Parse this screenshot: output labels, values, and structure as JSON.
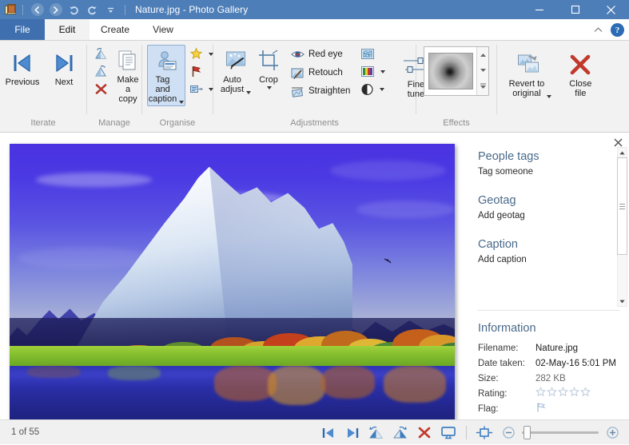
{
  "window": {
    "title": "Nature.jpg - Photo Gallery",
    "app_icon": "photo-gallery-icon",
    "quick_access": [
      {
        "name": "back-button",
        "icon": "back-arrow-icon"
      },
      {
        "name": "forward-button",
        "icon": "forward-arrow-icon"
      },
      {
        "name": "undo-button",
        "icon": "undo-icon"
      },
      {
        "name": "redo-button",
        "icon": "redo-icon"
      },
      {
        "name": "customize-quick-access-button",
        "icon": "chevron-down-icon"
      }
    ],
    "controls": {
      "minimize": "minimize-icon",
      "maximize": "maximize-icon",
      "close": "close-icon"
    }
  },
  "tabs": [
    {
      "label": "File",
      "type": "file",
      "active": false
    },
    {
      "label": "Edit",
      "type": "normal",
      "active": true
    },
    {
      "label": "Create",
      "type": "normal",
      "active": false
    },
    {
      "label": "View",
      "type": "normal",
      "active": false
    }
  ],
  "ribbon": {
    "collapse_icon": "chevron-up-icon",
    "help_label": "?",
    "groups": [
      {
        "label": "Iterate",
        "buttons": [
          {
            "label": "Previous",
            "icon": "previous-icon",
            "selected": false
          },
          {
            "label": "Next",
            "icon": "next-icon",
            "selected": false
          }
        ]
      },
      {
        "label": "Manage",
        "small_buttons": [
          {
            "label": "",
            "icon": "rotate-left-icon"
          },
          {
            "label": "",
            "icon": "rotate-right-icon"
          },
          {
            "label": "",
            "icon": "delete-x-icon"
          }
        ],
        "buttons": [
          {
            "label": "Make\na copy",
            "icon": "copy-icon",
            "selected": false
          }
        ]
      },
      {
        "label": "Organise",
        "buttons": [
          {
            "label": "Tag and\ncaption",
            "icon": "tag-person-icon",
            "selected": true,
            "has_menu": true
          }
        ],
        "small_buttons": [
          {
            "label": "",
            "icon": "star-rating-icon",
            "has_menu": true
          },
          {
            "label": "",
            "icon": "flag-icon",
            "has_menu": false
          },
          {
            "label": "",
            "icon": "caption-tag-icon",
            "has_menu": true
          }
        ]
      },
      {
        "label": "Adjustments",
        "buttons": [
          {
            "label": "Auto\nadjust",
            "icon": "auto-adjust-icon",
            "selected": false,
            "has_menu": true
          },
          {
            "label": "Crop",
            "icon": "crop-icon",
            "selected": false,
            "has_menu": true
          }
        ],
        "small_buttons": [
          {
            "label": "Red eye",
            "icon": "red-eye-icon"
          },
          {
            "label": "Retouch",
            "icon": "retouch-icon"
          },
          {
            "label": "Straighten",
            "icon": "straighten-icon"
          }
        ],
        "swatch_buttons": [
          {
            "label": "",
            "icon": "noise-reduction-icon",
            "has_menu": false
          },
          {
            "label": "",
            "icon": "color-adjust-icon",
            "has_menu": true
          },
          {
            "label": "",
            "icon": "exposure-icon",
            "has_menu": true
          }
        ],
        "fine_tune": {
          "label": "Fine\ntune",
          "icon": "fine-tune-sliders-icon"
        }
      },
      {
        "label": "Effects",
        "gallery": {
          "thumb_name": "effect-thumbnail-grayscale",
          "up_icon": "gallery-up-icon",
          "down_icon": "gallery-down-icon",
          "more_icon": "gallery-more-icon"
        }
      },
      {
        "label": "",
        "buttons": [
          {
            "label": "Revert to\noriginal",
            "icon": "revert-icon",
            "selected": false,
            "has_menu": true
          },
          {
            "label": "Close\nfile",
            "icon": "close-file-x-icon",
            "selected": false
          }
        ]
      }
    ]
  },
  "photo": {
    "name": "photo-canvas",
    "alt": "Snow-capped mountain with autumn trees reflected in a lake"
  },
  "sidebar": {
    "close_icon": "panel-close-icon",
    "sections": [
      {
        "heading": "People tags",
        "link": "Tag someone",
        "link_name": "tag-someone-link"
      },
      {
        "heading": "Geotag",
        "link": "Add geotag",
        "link_name": "add-geotag-link"
      },
      {
        "heading": "Caption",
        "link": "Add caption",
        "link_name": "add-caption-link"
      }
    ],
    "information": {
      "heading": "Information",
      "rows": [
        {
          "key": "Filename:",
          "value": "Nature.jpg",
          "type": "text"
        },
        {
          "key": "Date taken:",
          "value": "02-May-16  5:01 PM",
          "type": "text"
        },
        {
          "key": "Size:",
          "value": "282 KB",
          "type": "muted"
        },
        {
          "key": "Rating:",
          "value": "",
          "type": "stars",
          "stars_total": 5,
          "stars_filled": 0
        },
        {
          "key": "Flag:",
          "value": "",
          "type": "flag"
        }
      ]
    }
  },
  "statusbar": {
    "count": "1 of 55",
    "buttons": [
      {
        "name": "status-previous-button",
        "icon": "previous-icon"
      },
      {
        "name": "status-next-button",
        "icon": "next-icon"
      },
      {
        "name": "rotate-counterclockwise-button",
        "icon": "rotate-left-icon"
      },
      {
        "name": "rotate-clockwise-button",
        "icon": "rotate-right-icon"
      },
      {
        "name": "delete-button",
        "icon": "delete-x-icon"
      },
      {
        "name": "slideshow-button",
        "icon": "slideshow-icon"
      },
      {
        "name": "fit-to-window-button",
        "icon": "fit-to-window-icon"
      }
    ],
    "zoom": {
      "out_icon": "zoom-out-icon",
      "in_icon": "zoom-in-icon",
      "value": 0
    }
  },
  "colors": {
    "titlebar": "#4d7eb8",
    "file_tab": "#3f6fae",
    "ribbon_bg": "#f2f2f2",
    "accent_blue": "#2b6cb5",
    "heading_blue": "#4a6a8a",
    "delete_red": "#b33a2f"
  }
}
